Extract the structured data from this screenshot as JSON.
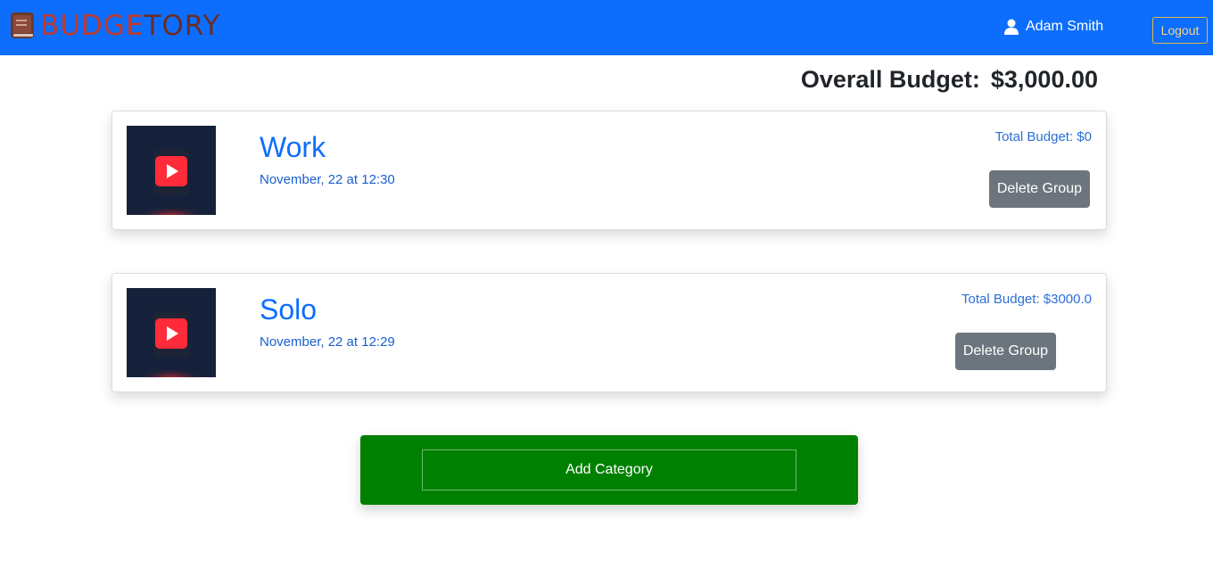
{
  "navbar": {
    "brand_part1": "BUDGE",
    "brand_part2": "TORY",
    "user_name": "Adam Smith",
    "logout_label": "Logout"
  },
  "overall": {
    "label": "Overall Budget:",
    "value": "$3,000.00"
  },
  "groups": [
    {
      "title": "Work",
      "date": "November, 22 at 12:30",
      "total": "Total Budget: $0",
      "delete_label": "Delete Group",
      "thumbnail_icon": "play-button-icon"
    },
    {
      "title": "Solo",
      "date": "November, 22 at 12:29",
      "total": "Total Budget: $3000.0",
      "delete_label": "Delete Group",
      "thumbnail_icon": "play-button-icon"
    }
  ],
  "add_category_label": "Add Category",
  "colors": {
    "navbar": "#0d6efd",
    "title": "#0d6efd",
    "delete_button": "#6c757d",
    "add_category": "#008000"
  }
}
